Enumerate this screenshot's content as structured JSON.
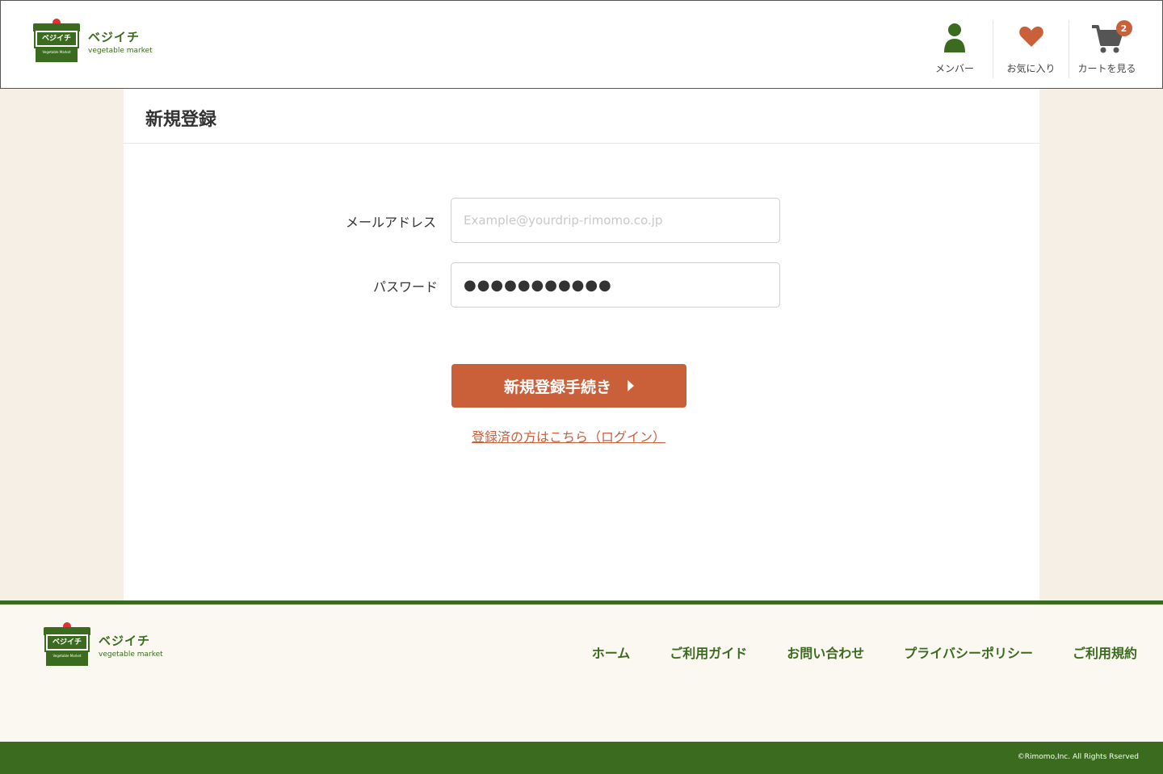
{
  "brand": {
    "name": "ベジイチ",
    "sub": "vegetable market",
    "sign": "ベジイチ",
    "stall_text": "Vegetable Market"
  },
  "header": {
    "member_label": "メンバー",
    "favorites_label": "お気に入り",
    "cart_label": "カートを見る",
    "cart_count": "2"
  },
  "page": {
    "title": "新規登録"
  },
  "form": {
    "email_label": "メールアドレス",
    "email_placeholder": "Example@yourdrip-rimomo.co.jp",
    "email_value": "",
    "password_label": "パスワード",
    "password_value": "●●●●●●●●●●●",
    "submit_label": "新規登録手続き",
    "login_link": "登録済の方はこちら（ログイン）"
  },
  "footer": {
    "nav": [
      "ホーム",
      "ご利用ガイド",
      "お問い合わせ",
      "プライバシーポリシー",
      "ご利用規約"
    ],
    "copyright": "©Rimomo,Inc. All Rights Rserved"
  },
  "colors": {
    "brand_green": "#3a6b1e",
    "accent_orange": "#c9603a",
    "page_bg": "#f5efe5"
  }
}
